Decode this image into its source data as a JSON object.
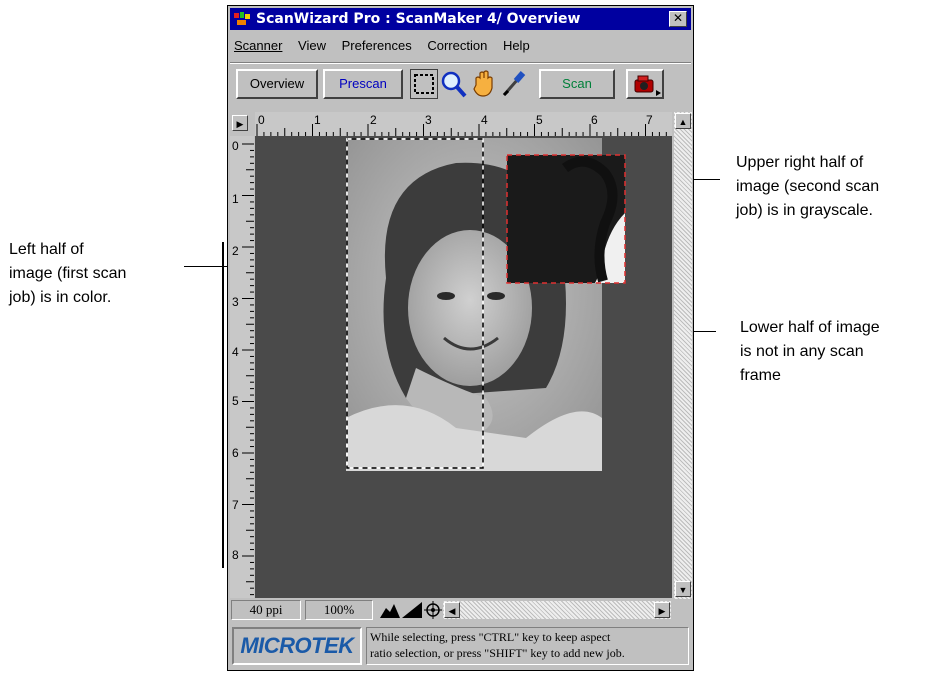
{
  "window": {
    "title": "ScanWizard Pro : ScanMaker 4/ Overview",
    "close_glyph": "✕"
  },
  "menu": [
    "Scanner",
    "View",
    "Preferences",
    "Correction",
    "Help"
  ],
  "toolbar": {
    "overview_label": "Overview",
    "prescan_label": "Prescan",
    "scan_label": "Scan",
    "icons": [
      "marquee-select-icon",
      "zoom-icon",
      "hand-pan-icon",
      "eyedropper-icon",
      "scanner-settings-icon"
    ]
  },
  "ruler": {
    "h_ticks": [
      "0",
      "1",
      "2",
      "3",
      "4",
      "5",
      "6",
      "7"
    ],
    "v_ticks": [
      "0",
      "1",
      "2",
      "3",
      "4",
      "5",
      "6",
      "7",
      "8"
    ]
  },
  "status_bar": {
    "resolution": "40 ppi",
    "zoom": "100%"
  },
  "footer": {
    "logo_text": "MICROTEK",
    "hint_line1": "While selecting, press \"CTRL\" key to keep aspect",
    "hint_line2": "ratio selection, or press \"SHIFT\" key to add new job."
  },
  "annotations": {
    "left": [
      "Left half of",
      "image (first scan",
      "job) is in color."
    ],
    "upper_right": [
      "Upper right half of",
      "image (second scan",
      "job) is in grayscale."
    ],
    "lower_right": [
      "Lower half of image",
      "is not in any scan",
      "frame"
    ]
  },
  "colors": {
    "title_bar": "#0000a0",
    "prescan_text": "#0000c0",
    "scan_button": "#00803a",
    "selection_frame_1": "#ffffff",
    "selection_frame_2": "#e03030"
  }
}
